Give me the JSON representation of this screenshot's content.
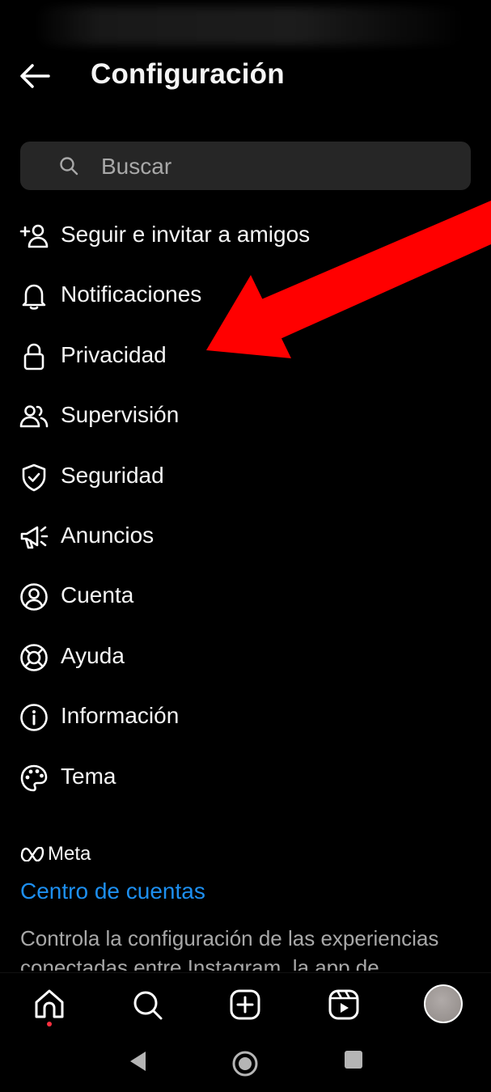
{
  "header": {
    "title": "Configuración"
  },
  "search": {
    "placeholder": "Buscar"
  },
  "menu": {
    "items": [
      {
        "label": "Seguir e invitar a amigos",
        "icon": "add-person-icon"
      },
      {
        "label": "Notificaciones",
        "icon": "bell-icon"
      },
      {
        "label": "Privacidad",
        "icon": "lock-icon"
      },
      {
        "label": "Supervisión",
        "icon": "people-icon"
      },
      {
        "label": "Seguridad",
        "icon": "shield-check-icon"
      },
      {
        "label": "Anuncios",
        "icon": "megaphone-icon"
      },
      {
        "label": "Cuenta",
        "icon": "account-circle-icon"
      },
      {
        "label": "Ayuda",
        "icon": "lifebuoy-icon"
      },
      {
        "label": "Información",
        "icon": "info-icon"
      },
      {
        "label": "Tema",
        "icon": "palette-icon"
      }
    ]
  },
  "meta": {
    "brand": "Meta"
  },
  "accounts_center": {
    "link": "Centro de cuentas",
    "description": "Controla la configuración de las experiencias conectadas entre Instagram, la app de"
  },
  "colors": {
    "background": "#000000",
    "search_bg": "#262626",
    "link": "#1d8ff0",
    "annotation_arrow": "#ff0000"
  }
}
